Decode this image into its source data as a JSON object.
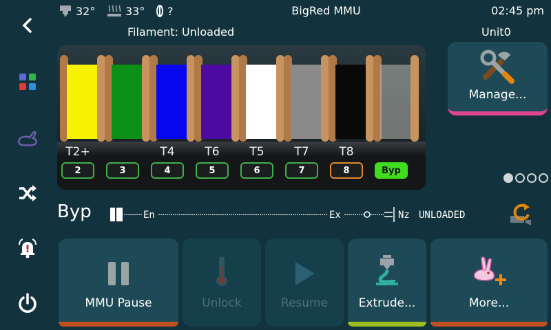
{
  "header": {
    "extruder_temp": "32°",
    "bed_temp": "33°",
    "filament_sensor": "?",
    "title": "BigRed MMU",
    "time": "02:45 pm"
  },
  "status": {
    "filament": "Filament: Unloaded",
    "unit": "Unit0"
  },
  "nav": [
    {
      "icon": "back-arrow-icon"
    },
    {
      "icon": "apps-grid-icon"
    },
    {
      "icon": "rabbit-icon"
    },
    {
      "icon": "shuffle-icon"
    },
    {
      "icon": "alarm-bell-icon"
    },
    {
      "icon": "power-icon"
    }
  ],
  "spools": [
    {
      "color": "#f7f200",
      "tool": "T2+",
      "gate": "2"
    },
    {
      "color": "#0a8f17",
      "tool": "",
      "gate": "3"
    },
    {
      "color": "#0808f0",
      "tool": "T4",
      "gate": "4"
    },
    {
      "color": "#4c0aa0",
      "tool": "T6",
      "gate": "5"
    },
    {
      "color": "#ffffff",
      "tool": "T5",
      "gate": "6"
    },
    {
      "color": "#8a8a8a",
      "tool": "T7",
      "gate": "7"
    },
    {
      "color": "#0a0a0a",
      "tool": "T8",
      "gate": "8"
    },
    {
      "color": "#b8b8b0",
      "tool": "",
      "gate": "Byp"
    }
  ],
  "manage": {
    "label": "Manage..."
  },
  "path": {
    "gate": "Byp",
    "entry": "En",
    "exit": "Ex",
    "nozzle": "Nz",
    "state": "UNLOADED"
  },
  "pages": {
    "count": 4,
    "active": 0
  },
  "actions": [
    {
      "label": "MMU Pause",
      "enabled": true,
      "bar": "#c0501f"
    },
    {
      "label": "Unlock",
      "enabled": false,
      "bar": ""
    },
    {
      "label": "Resume",
      "enabled": false,
      "bar": ""
    },
    {
      "label": "Extrude...",
      "enabled": true,
      "bar": "#9bbd1e"
    },
    {
      "label": "More...",
      "enabled": true,
      "bar": "#c0501f"
    }
  ]
}
